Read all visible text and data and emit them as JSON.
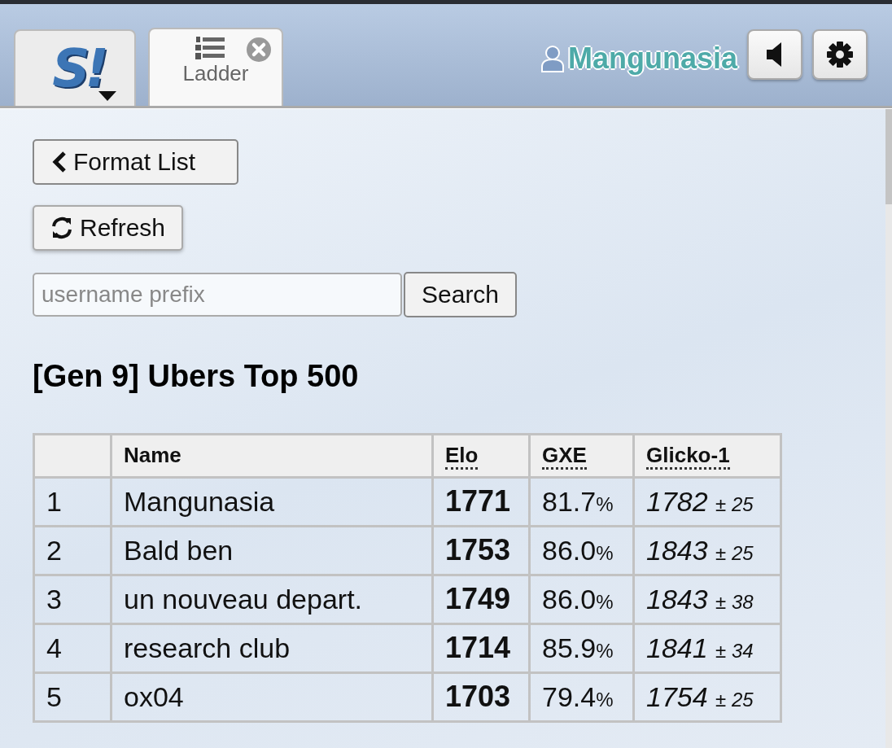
{
  "header": {
    "logo": {
      "text": "S!"
    },
    "tabs": [
      {
        "kind": "home",
        "selected": false
      },
      {
        "kind": "ladder",
        "label": "Ladder",
        "selected": true,
        "closable": true
      }
    ],
    "user": {
      "name": "Mangunasia"
    },
    "buttons": [
      {
        "kind": "sound"
      },
      {
        "kind": "settings"
      }
    ]
  },
  "controls": {
    "back_button": "Format List",
    "refresh_button": "Refresh",
    "search": {
      "placeholder": "username prefix",
      "button": "Search"
    }
  },
  "title": "[Gen 9] Ubers Top 500",
  "table": {
    "columns": [
      {
        "label": "Name",
        "dotted": false
      },
      {
        "label": "Elo",
        "dotted": true
      },
      {
        "label": "GXE",
        "dotted": true
      },
      {
        "label": "Glicko-1",
        "dotted": true
      }
    ],
    "rows": [
      {
        "rank": "1",
        "name": "Mangunasia",
        "elo": "1771",
        "gxe": "81.7",
        "gxe_unit": "%",
        "glicko": "1782",
        "deviation": "± 25"
      },
      {
        "rank": "2",
        "name": "Bald ben",
        "elo": "1753",
        "gxe": "86.0",
        "gxe_unit": "%",
        "glicko": "1843",
        "deviation": "± 25"
      },
      {
        "rank": "3",
        "name": "un nouveau depart.",
        "elo": "1749",
        "gxe": "86.0",
        "gxe_unit": "%",
        "glicko": "1843",
        "deviation": "± 38"
      },
      {
        "rank": "4",
        "name": "research club",
        "elo": "1714",
        "gxe": "85.9",
        "gxe_unit": "%",
        "glicko": "1841",
        "deviation": "± 34"
      },
      {
        "rank": "5",
        "name": "ox04",
        "elo": "1703",
        "gxe": "79.4",
        "gxe_unit": "%",
        "glicko": "1754",
        "deviation": "± 25"
      }
    ]
  }
}
